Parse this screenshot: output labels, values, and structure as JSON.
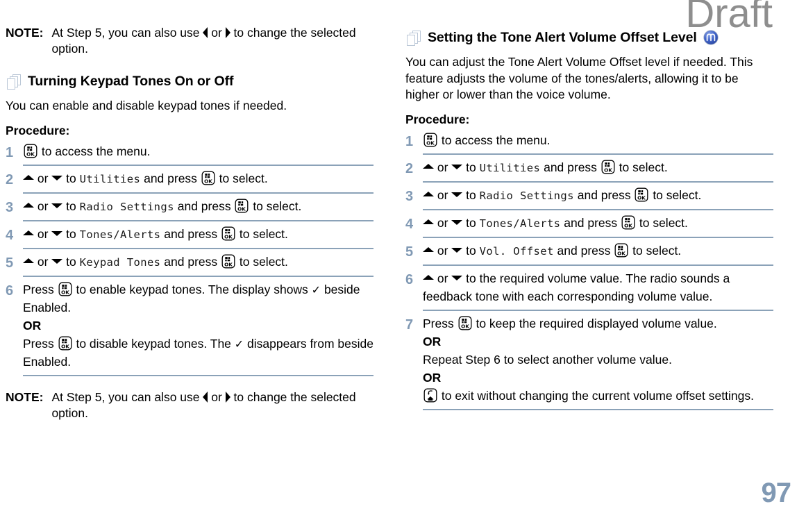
{
  "watermark": "Draft",
  "page_number": "97",
  "colors": {
    "step_number": "#8099b4",
    "rule": "#8ba2b8",
    "page_icon_outline": "#b9c6d6",
    "watermark": "#8e8e8e",
    "feature_icon_blue": "#3b5fc0"
  },
  "icons": {
    "ok_button": "ok-button-icon",
    "back_home_button": "back-home-button-icon",
    "pages_stack": "pages-stack-icon",
    "tone_alert_feature": "tone-alert-feature-icon",
    "arrow_up": "arrow-up-icon",
    "arrow_down": "arrow-down-icon",
    "arrow_left": "arrow-left-icon",
    "arrow_right": "arrow-right-icon",
    "checkmark": "checkmark-icon"
  },
  "left_column": {
    "top_note": {
      "label": "NOTE:",
      "text_before_left": "At Step 5, you can also use ",
      "text_between": " or ",
      "text_after_right": " to change the selected option."
    },
    "heading": "Turning Keypad Tones On or Off",
    "intro": "You can enable and disable keypad tones if needed.",
    "procedure_label": "Procedure:",
    "steps": [
      {
        "num": "1",
        "parts": [
          {
            "type": "icon",
            "value": "ok-button-icon"
          },
          {
            "type": "text",
            "value": " to access the menu."
          }
        ]
      },
      {
        "num": "2",
        "parts": [
          {
            "type": "icon",
            "value": "arrow-up-icon"
          },
          {
            "type": "text",
            "value": " or "
          },
          {
            "type": "icon",
            "value": "arrow-down-icon"
          },
          {
            "type": "text",
            "value": " to "
          },
          {
            "type": "lcd",
            "value": "Utilities"
          },
          {
            "type": "text",
            "value": " and press "
          },
          {
            "type": "icon",
            "value": "ok-button-icon"
          },
          {
            "type": "text",
            "value": " to select."
          }
        ]
      },
      {
        "num": "3",
        "parts": [
          {
            "type": "icon",
            "value": "arrow-up-icon"
          },
          {
            "type": "text",
            "value": " or "
          },
          {
            "type": "icon",
            "value": "arrow-down-icon"
          },
          {
            "type": "text",
            "value": " to "
          },
          {
            "type": "lcd",
            "value": "Radio Settings"
          },
          {
            "type": "text",
            "value": " and press "
          },
          {
            "type": "icon",
            "value": "ok-button-icon"
          },
          {
            "type": "text",
            "value": " to select."
          }
        ]
      },
      {
        "num": "4",
        "parts": [
          {
            "type": "icon",
            "value": "arrow-up-icon"
          },
          {
            "type": "text",
            "value": " or "
          },
          {
            "type": "icon",
            "value": "arrow-down-icon"
          },
          {
            "type": "text",
            "value": " to "
          },
          {
            "type": "lcd",
            "value": "Tones/Alerts"
          },
          {
            "type": "text",
            "value": " and press "
          },
          {
            "type": "icon",
            "value": "ok-button-icon"
          },
          {
            "type": "text",
            "value": " to select."
          }
        ]
      },
      {
        "num": "5",
        "parts": [
          {
            "type": "icon",
            "value": "arrow-up-icon"
          },
          {
            "type": "text",
            "value": " or "
          },
          {
            "type": "icon",
            "value": "arrow-down-icon"
          },
          {
            "type": "text",
            "value": " to "
          },
          {
            "type": "lcd",
            "value": "Keypad Tones"
          },
          {
            "type": "text",
            "value": " and press "
          },
          {
            "type": "icon",
            "value": "ok-button-icon"
          },
          {
            "type": "text",
            "value": " to select."
          }
        ]
      },
      {
        "num": "6",
        "parts": [
          {
            "type": "text",
            "value": "Press "
          },
          {
            "type": "icon",
            "value": "ok-button-icon"
          },
          {
            "type": "text",
            "value": " to enable keypad tones. The display shows "
          },
          {
            "type": "icon",
            "value": "checkmark-icon"
          },
          {
            "type": "text",
            "value": " beside Enabled."
          },
          {
            "type": "br"
          },
          {
            "type": "bold",
            "value": "OR"
          },
          {
            "type": "br"
          },
          {
            "type": "text",
            "value": "Press "
          },
          {
            "type": "icon",
            "value": "ok-button-icon"
          },
          {
            "type": "text",
            "value": " to disable keypad tones. The "
          },
          {
            "type": "icon",
            "value": "checkmark-icon"
          },
          {
            "type": "text",
            "value": " disappears from beside Enabled."
          }
        ]
      }
    ],
    "bottom_note": {
      "label": "NOTE:",
      "text_before_left": "At Step 5, you can also use ",
      "text_between": " or ",
      "text_after_right": " to change the selected option."
    }
  },
  "right_column": {
    "heading": "Setting the Tone Alert Volume Offset Level",
    "intro": "You can adjust the Tone Alert Volume Offset level if needed. This feature adjusts the volume of the tones/alerts, allowing it to be higher or lower than the voice volume.",
    "procedure_label": "Procedure:",
    "steps": [
      {
        "num": "1",
        "parts": [
          {
            "type": "icon",
            "value": "ok-button-icon"
          },
          {
            "type": "text",
            "value": " to access the menu."
          }
        ]
      },
      {
        "num": "2",
        "parts": [
          {
            "type": "icon",
            "value": "arrow-up-icon"
          },
          {
            "type": "text",
            "value": " or "
          },
          {
            "type": "icon",
            "value": "arrow-down-icon"
          },
          {
            "type": "text",
            "value": " to "
          },
          {
            "type": "lcd",
            "value": "Utilities"
          },
          {
            "type": "text",
            "value": " and press "
          },
          {
            "type": "icon",
            "value": "ok-button-icon"
          },
          {
            "type": "text",
            "value": " to select."
          }
        ]
      },
      {
        "num": "3",
        "parts": [
          {
            "type": "icon",
            "value": "arrow-up-icon"
          },
          {
            "type": "text",
            "value": " or "
          },
          {
            "type": "icon",
            "value": "arrow-down-icon"
          },
          {
            "type": "text",
            "value": " to "
          },
          {
            "type": "lcd",
            "value": "Radio Settings"
          },
          {
            "type": "text",
            "value": " and press "
          },
          {
            "type": "icon",
            "value": "ok-button-icon"
          },
          {
            "type": "text",
            "value": " to select."
          }
        ]
      },
      {
        "num": "4",
        "parts": [
          {
            "type": "icon",
            "value": "arrow-up-icon"
          },
          {
            "type": "text",
            "value": " or "
          },
          {
            "type": "icon",
            "value": "arrow-down-icon"
          },
          {
            "type": "text",
            "value": " to "
          },
          {
            "type": "lcd",
            "value": "Tones/Alerts"
          },
          {
            "type": "text",
            "value": " and press "
          },
          {
            "type": "icon",
            "value": "ok-button-icon"
          },
          {
            "type": "text",
            "value": " to select."
          }
        ]
      },
      {
        "num": "5",
        "parts": [
          {
            "type": "icon",
            "value": "arrow-up-icon"
          },
          {
            "type": "text",
            "value": " or "
          },
          {
            "type": "icon",
            "value": "arrow-down-icon"
          },
          {
            "type": "text",
            "value": " to "
          },
          {
            "type": "lcd",
            "value": "Vol. Offset"
          },
          {
            "type": "text",
            "value": " and press "
          },
          {
            "type": "icon",
            "value": "ok-button-icon"
          },
          {
            "type": "text",
            "value": " to select."
          }
        ]
      },
      {
        "num": "6",
        "parts": [
          {
            "type": "icon",
            "value": "arrow-up-icon"
          },
          {
            "type": "text",
            "value": " or "
          },
          {
            "type": "icon",
            "value": "arrow-down-icon"
          },
          {
            "type": "text",
            "value": " to the required volume value. The radio sounds a feedback tone with each corresponding volume value."
          }
        ]
      },
      {
        "num": "7",
        "parts": [
          {
            "type": "text",
            "value": "Press "
          },
          {
            "type": "icon",
            "value": "ok-button-icon"
          },
          {
            "type": "text",
            "value": " to keep the required displayed volume value."
          },
          {
            "type": "br"
          },
          {
            "type": "bold",
            "value": "OR"
          },
          {
            "type": "br"
          },
          {
            "type": "text",
            "value": "Repeat Step 6 to select another volume value."
          },
          {
            "type": "br"
          },
          {
            "type": "bold",
            "value": "OR"
          },
          {
            "type": "br"
          },
          {
            "type": "icon",
            "value": "back-home-button-icon"
          },
          {
            "type": "text",
            "value": " to exit without changing the current volume offset settings."
          }
        ]
      }
    ]
  }
}
